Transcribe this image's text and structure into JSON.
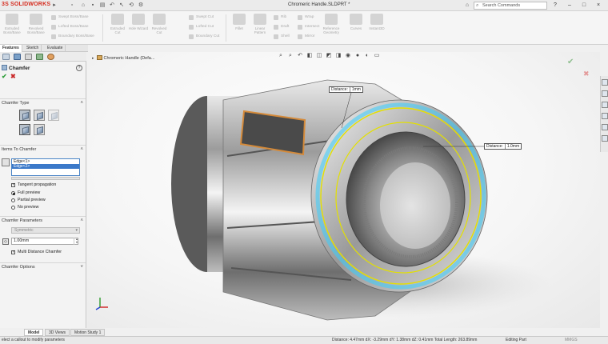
{
  "app": {
    "logo_text": "SOLIDWORKS",
    "doc_title": "Chromeric Handle.SLDPRT *",
    "search_placeholder": "Search Commands",
    "window_buttons": [
      "?",
      "–",
      "□",
      "×"
    ]
  },
  "ribbon": {
    "tools_big": [
      {
        "label": "Extruded Boss/Base",
        "icon": "extrude-boss-icon"
      },
      {
        "label": "Revolved Boss/Base",
        "icon": "revolve-boss-icon"
      },
      {
        "label": "Extruded Cut",
        "icon": "extrude-cut-icon"
      },
      {
        "label": "Hole Wizard",
        "icon": "hole-wizard-icon"
      },
      {
        "label": "Revolved Cut",
        "icon": "revolve-cut-icon"
      },
      {
        "label": "Fillet",
        "icon": "fillet-icon"
      },
      {
        "label": "Linear Pattern",
        "icon": "linear-pattern-icon"
      },
      {
        "label": "Reference Geometry",
        "icon": "reference-geometry-icon"
      },
      {
        "label": "Curves",
        "icon": "curves-icon"
      },
      {
        "label": "Instant3D",
        "icon": "instant3d-icon"
      }
    ],
    "tools_small": [
      "Swept Boss/Base",
      "Lofted Boss/Base",
      "Boundary Boss/Base",
      "Swept Cut",
      "Lofted Cut",
      "Boundary Cut",
      "Rib",
      "Draft",
      "Shell",
      "Wrap",
      "Intersect",
      "Mirror"
    ]
  },
  "tabs": [
    "Features",
    "Sketch",
    "Evaluate"
  ],
  "property_manager": {
    "title": "Chamfer",
    "sections": {
      "chamfer_type": "Chamfer Type",
      "items": "Items To Chamfer",
      "parameters": "Chamfer Parameters",
      "options": "Chamfer Options"
    },
    "edges": [
      "Edge<1>",
      "Edge<2>"
    ],
    "tangent_propagation": "Tangent propagation",
    "preview_options": [
      "Full preview",
      "Partial preview",
      "No preview"
    ],
    "parameter_mode": "Symmetric",
    "distance_value": "1.00mm",
    "multi_distance": "Multi Distance Chamfer"
  },
  "viewport": {
    "tree_item": "Chromeric Handle (Defa...",
    "callout_1_label": "Distance:",
    "callout_1_value": "1mm",
    "callout_2_label": "Distance:",
    "callout_2_value": "1.0mm",
    "triad": {
      "x": "X",
      "y": "Y",
      "z": "Z"
    }
  },
  "bottom_tabs": [
    "Model",
    "3D Views",
    "Motion Study 1"
  ],
  "status": {
    "hint": "elect a callout to modify parameters",
    "measurement": "Distance: 4.47mm   dX: -3.29mm   dY: 1.38mm   dZ: 0.41mm   Total Length: 263.89mm",
    "mode": "Editing Part",
    "units": "MMGS"
  },
  "colors": {
    "accent_red": "#d52b1e",
    "selection_blue": "#3b79c9",
    "ok_green": "#2e9e3a",
    "cancel_red": "#c92a2a",
    "highlight_yellow": "#e3e000",
    "highlight_cyan": "#38d0ff",
    "face_orange": "#d48a3a"
  }
}
